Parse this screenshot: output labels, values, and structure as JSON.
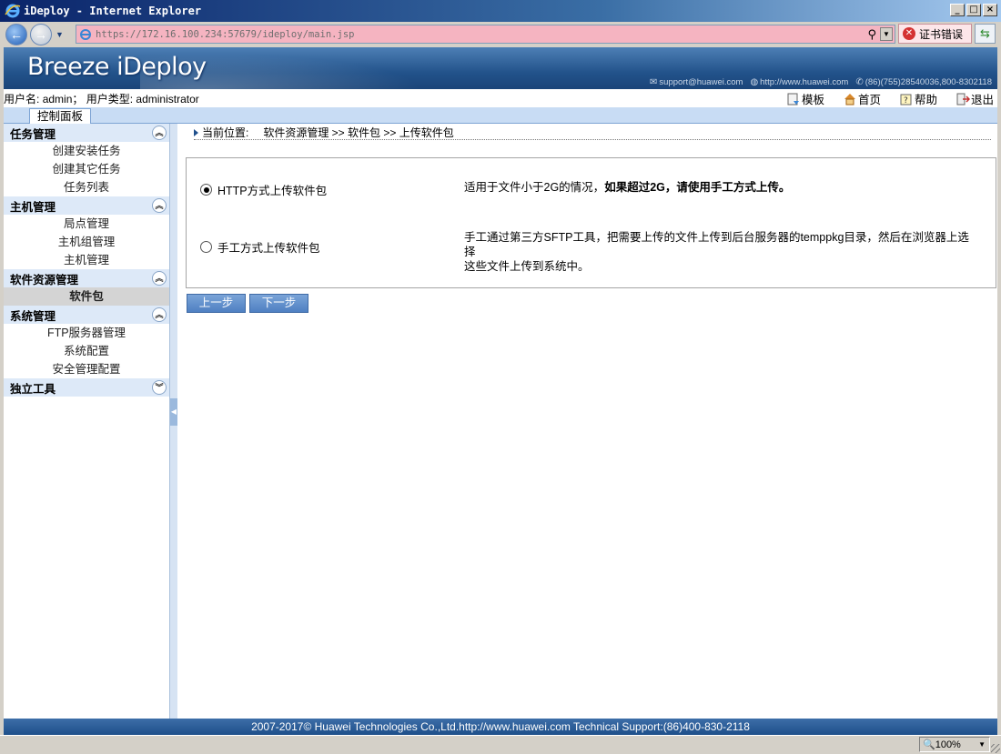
{
  "window": {
    "title": "iDeploy - Internet Explorer",
    "controls": {
      "minimize": "_",
      "maximize": "□",
      "close": "×"
    }
  },
  "browser": {
    "url": "https://172.16.100.234:57679/ideploy/main.jsp",
    "cert_error_label": "证书错误",
    "zoom_label": "100%",
    "icons": {
      "back": "back-arrow-icon",
      "forward": "forward-arrow-icon",
      "refresh": "refresh-icon",
      "search": "search-icon"
    }
  },
  "banner": {
    "logo": "Breeze iDeploy",
    "email": "support@huawei.com",
    "website": "http://www.huawei.com",
    "phone": "(86)(755)28540036,800-8302118"
  },
  "userbar": {
    "username_label": "用户名:",
    "username": "admin；",
    "usertype_label": "用户类型:",
    "usertype": "administrator",
    "links": [
      {
        "label": "模板",
        "icon": "template-icon"
      },
      {
        "label": "首页",
        "icon": "home-icon"
      },
      {
        "label": "帮助",
        "icon": "help-icon"
      },
      {
        "label": "退出",
        "icon": "exit-icon"
      }
    ]
  },
  "tabs": {
    "active": "控制面板"
  },
  "sidebar": {
    "sections": [
      {
        "title": "任务管理",
        "expanded": true,
        "items": [
          "创建安装任务",
          "创建其它任务",
          "任务列表"
        ]
      },
      {
        "title": "主机管理",
        "expanded": true,
        "items": [
          "局点管理",
          "主机组管理",
          "主机管理"
        ]
      },
      {
        "title": "软件资源管理",
        "expanded": true,
        "items": [
          "软件包"
        ],
        "active_item": "软件包"
      },
      {
        "title": "系统管理",
        "expanded": true,
        "items": [
          "FTP服务器管理",
          "系统配置",
          "安全管理配置"
        ]
      },
      {
        "title": "独立工具",
        "expanded": false,
        "items": []
      }
    ]
  },
  "breadcrumb": {
    "label": "当前位置:",
    "path": "软件资源管理 >> 软件包 >> 上传软件包"
  },
  "upload_options": [
    {
      "label": "HTTP方式上传软件包",
      "selected": true,
      "desc_prefix": "适用于文件小于2G的情况，",
      "desc_bold": "如果超过2G，请使用手工方式上传。"
    },
    {
      "label": "手工方式上传软件包",
      "selected": false,
      "desc_line1": "手工通过第三方SFTP工具，把需要上传的文件上传到后台服务器的temppkg目录，然后在浏览器上选择",
      "desc_line2": "这些文件上传到系统中。"
    }
  ],
  "buttons": {
    "prev": "上一步",
    "next": "下一步"
  },
  "footer": {
    "text": "2007-2017© Huawei Technologies Co.,Ltd.http://www.huawei.com    Technical Support:(86)400-830-2118"
  },
  "colors": {
    "banner": "#22528a",
    "accent": "#4f80c2",
    "sidebar_header": "#dde9f8",
    "address_bar_error": "#f5b4c1"
  }
}
